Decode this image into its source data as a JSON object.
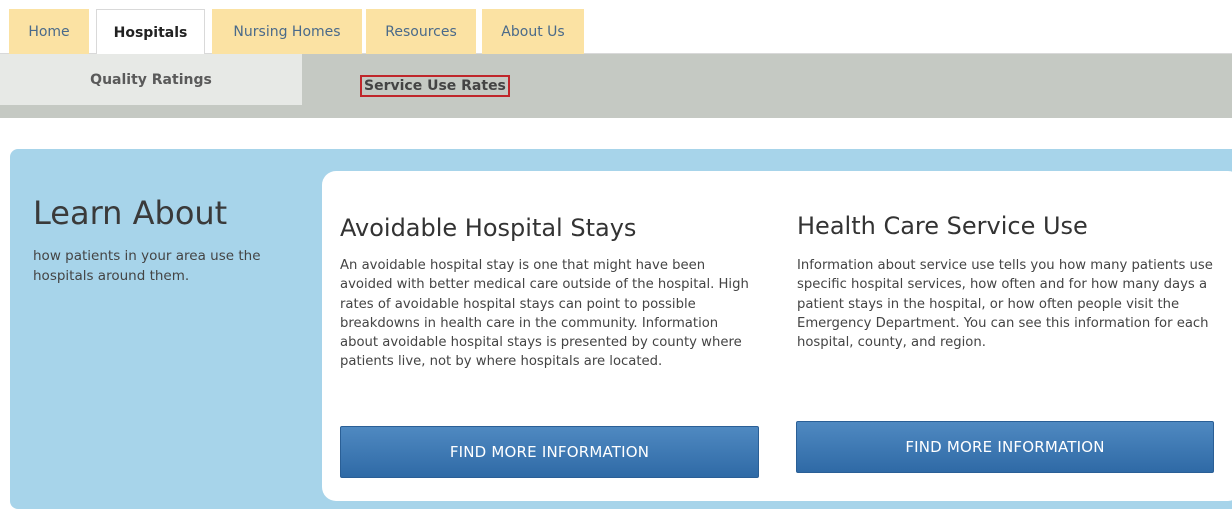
{
  "nav": {
    "tabs": [
      {
        "label": "Home",
        "active": false
      },
      {
        "label": "Hospitals",
        "active": true
      },
      {
        "label": "Nursing Homes",
        "active": false
      },
      {
        "label": "Resources",
        "active": false
      },
      {
        "label": "About Us",
        "active": false
      }
    ]
  },
  "subnav": {
    "items": [
      {
        "label": "Quality Ratings",
        "active": true
      },
      {
        "label": "Service Use Rates",
        "highlighted": true
      }
    ]
  },
  "learn": {
    "title": "Learn About",
    "subtitle": "how patients in your area use the hospitals around them."
  },
  "columns": [
    {
      "title": "Avoidable Hospital Stays",
      "body": "An avoidable hospital stay is one that might have been avoided with better medical care outside of the hospital. High rates of avoidable hospital stays can point to possible breakdowns in health care in the community. Information about avoidable hospital stays is presented by county where patients live, not by where hospitals are located.",
      "button_label": "FIND MORE INFORMATION"
    },
    {
      "title": "Health Care Service Use",
      "body": "Information about service use tells you how many patients use specific hospital services, how often and for how many days a patient stays in the hospital, or how often people visit the Emergency Department. You can see this information for each hospital, county, and region.",
      "button_label": "FIND MORE INFORMATION"
    }
  ],
  "colors": {
    "tab_bg": "#fbe2a3",
    "subnav_bg": "#c5c9c3",
    "panel_bg": "#a7d4ea",
    "button_bg": "#3d78b4",
    "highlight_border": "#c0262a"
  }
}
